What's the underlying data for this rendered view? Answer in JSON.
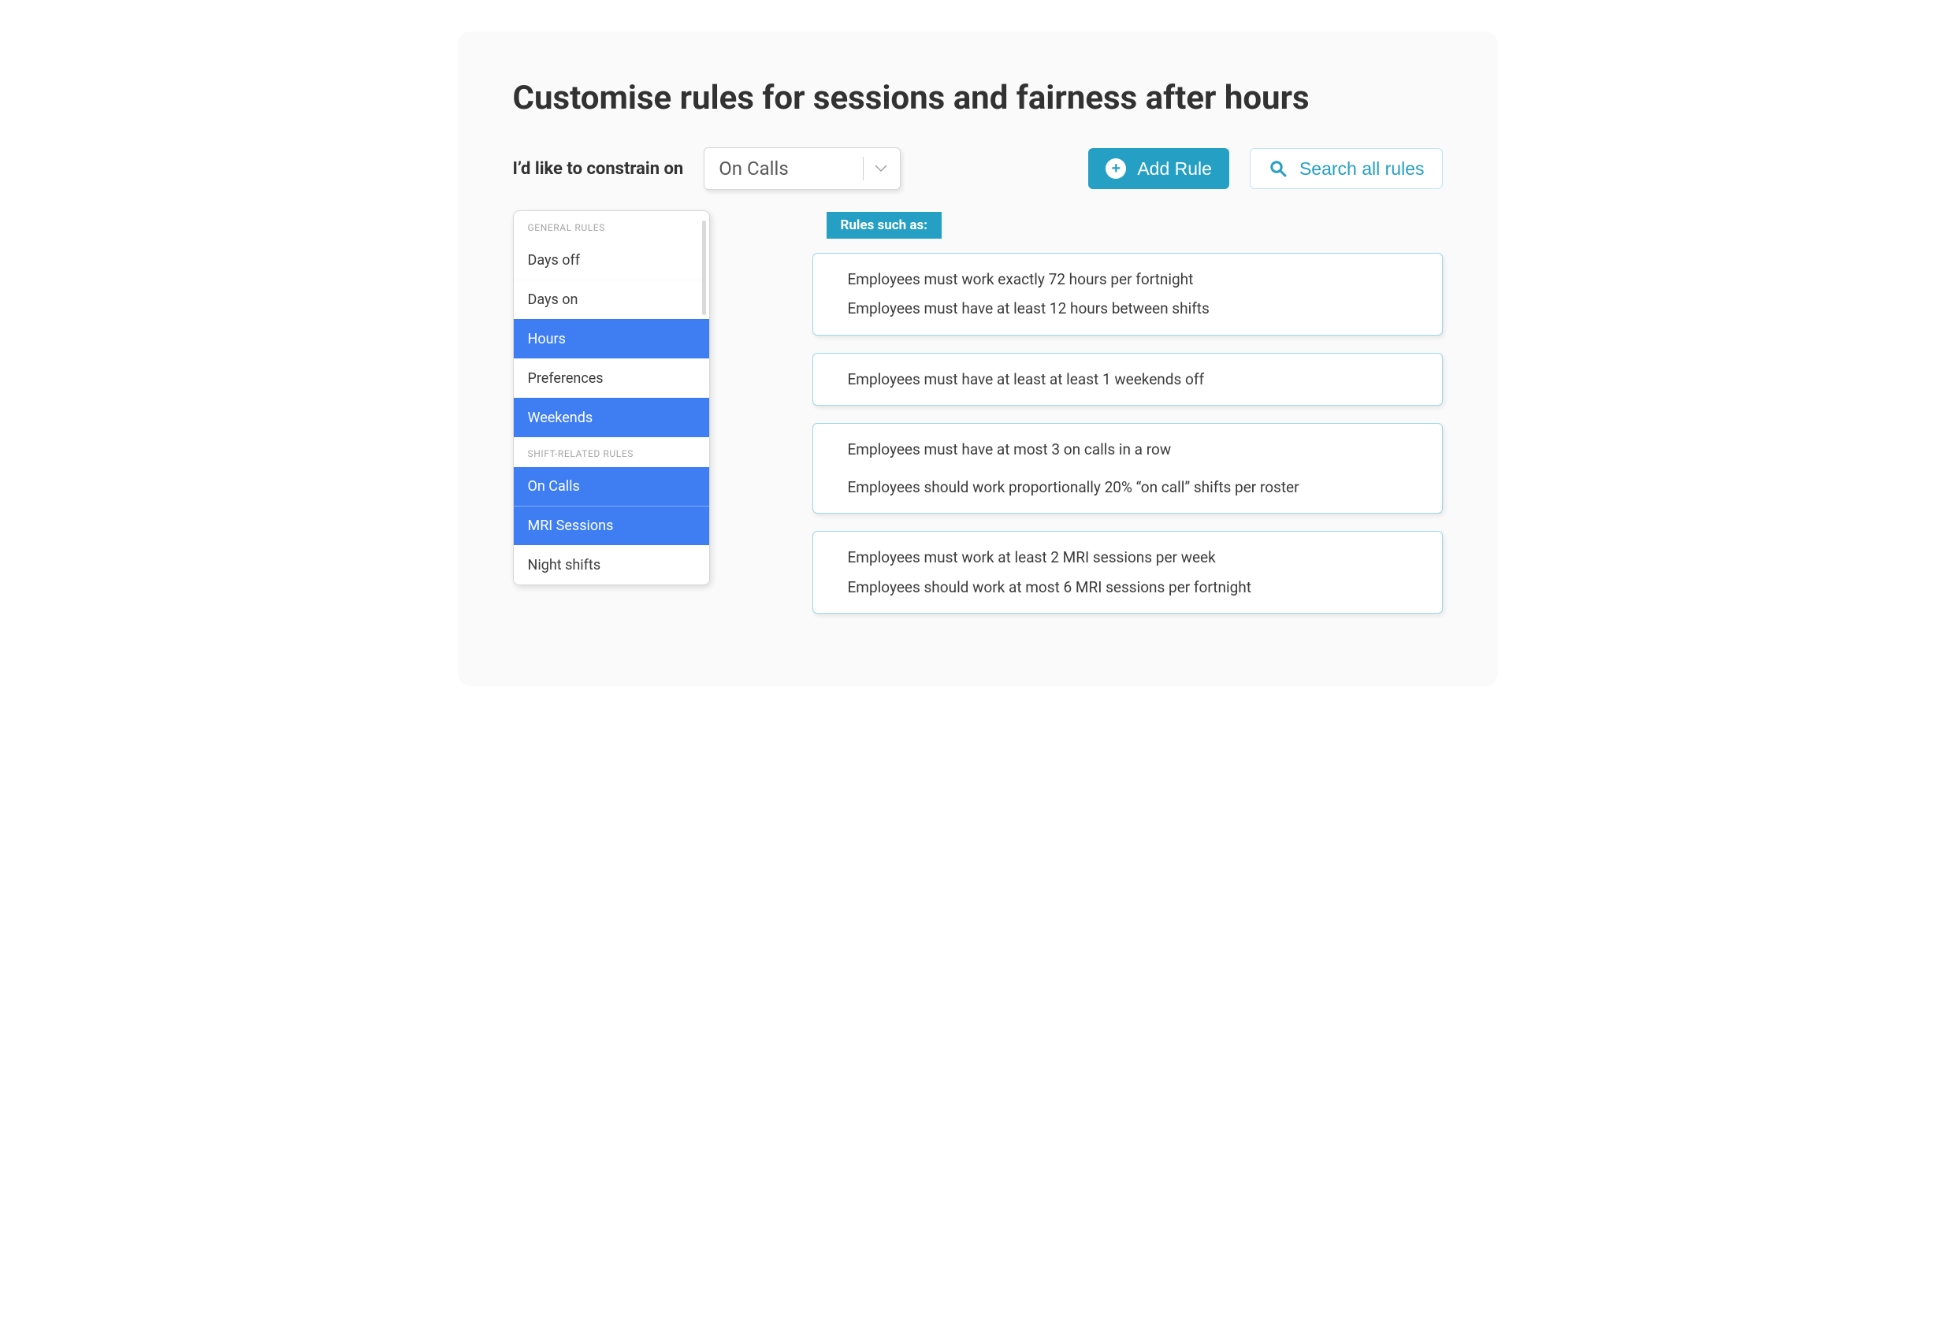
{
  "title": "Customise rules for sessions and fairness after hours",
  "toolbar": {
    "constrain_label": "I’d like to constrain on",
    "dropdown_value": "On Calls",
    "add_rule_label": "Add Rule",
    "search_label": "Search all rules"
  },
  "sidebar": {
    "section1_label": "GENERAL RULES",
    "items1": [
      {
        "label": "Days off",
        "selected": false
      },
      {
        "label": "Days on",
        "selected": false
      },
      {
        "label": "Hours",
        "selected": true
      },
      {
        "label": "Preferences",
        "selected": false
      },
      {
        "label": "Weekends",
        "selected": true
      }
    ],
    "section2_label": "SHIFT-RELATED RULES",
    "items2": [
      {
        "label": "On Calls",
        "selected": true
      },
      {
        "label": "MRI Sessions",
        "selected": true
      },
      {
        "label": "Night shifts",
        "selected": false
      }
    ]
  },
  "main": {
    "rules_badge": "Rules such as:",
    "cards": [
      {
        "lines": [
          "Employees must work exactly 72 hours per fortnight",
          "Employees must have at least 12 hours between shifts"
        ],
        "spaced": false
      },
      {
        "lines": [
          "Employees must have at least at least 1 weekends off"
        ],
        "spaced": false
      },
      {
        "lines": [
          "Employees must have at most 3 on calls in a row",
          "Employees should work proportionally 20% “on call” shifts per roster"
        ],
        "spaced": true
      },
      {
        "lines": [
          "Employees must work at least 2 MRI sessions per week",
          "Employees should work at most 6 MRI sessions per fortnight"
        ],
        "spaced": false
      }
    ]
  },
  "colors": {
    "accent_teal": "#259fc4",
    "accent_blue": "#3e7ef2"
  }
}
